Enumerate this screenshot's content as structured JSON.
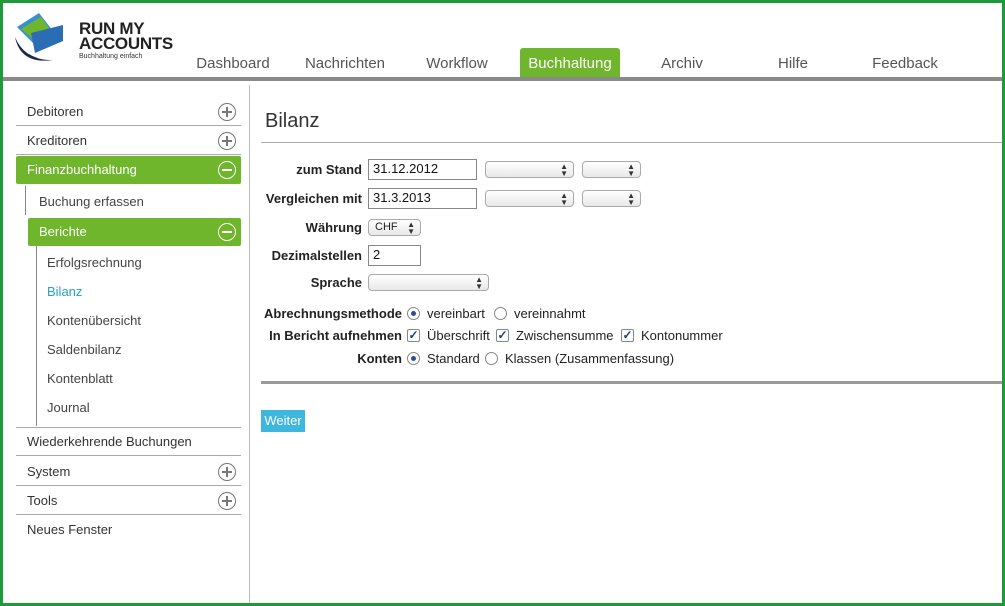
{
  "logo": {
    "line1": "RUN MY",
    "line2": "ACCOUNTS",
    "tagline": "Buchhaltung einfach"
  },
  "nav": {
    "tabs": [
      {
        "label": "Dashboard"
      },
      {
        "label": "Nachrichten"
      },
      {
        "label": "Workflow"
      },
      {
        "label": "Buchhaltung",
        "active": true
      },
      {
        "label": "Archiv"
      },
      {
        "label": "Hilfe"
      },
      {
        "label": "Feedback"
      }
    ]
  },
  "sidebar": {
    "debitoren": "Debitoren",
    "kreditoren": "Kreditoren",
    "finanzbuchhaltung": "Finanzbuchhaltung",
    "buchung_erfassen": "Buchung erfassen",
    "berichte": "Berichte",
    "reports": [
      "Erfolgsrechnung",
      "Bilanz",
      "Kontenübersicht",
      "Saldenbilanz",
      "Kontenblatt",
      "Journal"
    ],
    "wiederkehrende": "Wiederkehrende Buchungen",
    "system": "System",
    "tools": "Tools",
    "neues_fenster": "Neues Fenster"
  },
  "main": {
    "title": "Bilanz",
    "labels": {
      "zum_stand": "zum Stand",
      "vergleichen": "Vergleichen mit",
      "waehrung": "Währung",
      "dezimalstellen": "Dezimalstellen",
      "sprache": "Sprache",
      "abrechnungsmethode": "Abrechnungsmethode",
      "in_bericht": "In Bericht aufnehmen",
      "konten": "Konten"
    },
    "values": {
      "zum_stand": "31.12.2012",
      "vergleichen": "31.3.2013",
      "waehrung": "CHF",
      "dezimalstellen": "2"
    },
    "abrechnung_options": {
      "vereinbart": "vereinbart",
      "vereinnahmt": "vereinnahmt"
    },
    "include_options": {
      "ueberschrift": "Überschrift",
      "zwischensumme": "Zwischensumme",
      "kontonummer": "Kontonummer"
    },
    "konten_options": {
      "standard": "Standard",
      "klassen": "Klassen (Zusammenfassung)"
    },
    "button": "Weiter"
  },
  "colors": {
    "accent_green": "#6fb62c",
    "frame_green": "#1e9a3a",
    "button_blue": "#3eb6dd",
    "link_blue": "#2a9ec8"
  }
}
